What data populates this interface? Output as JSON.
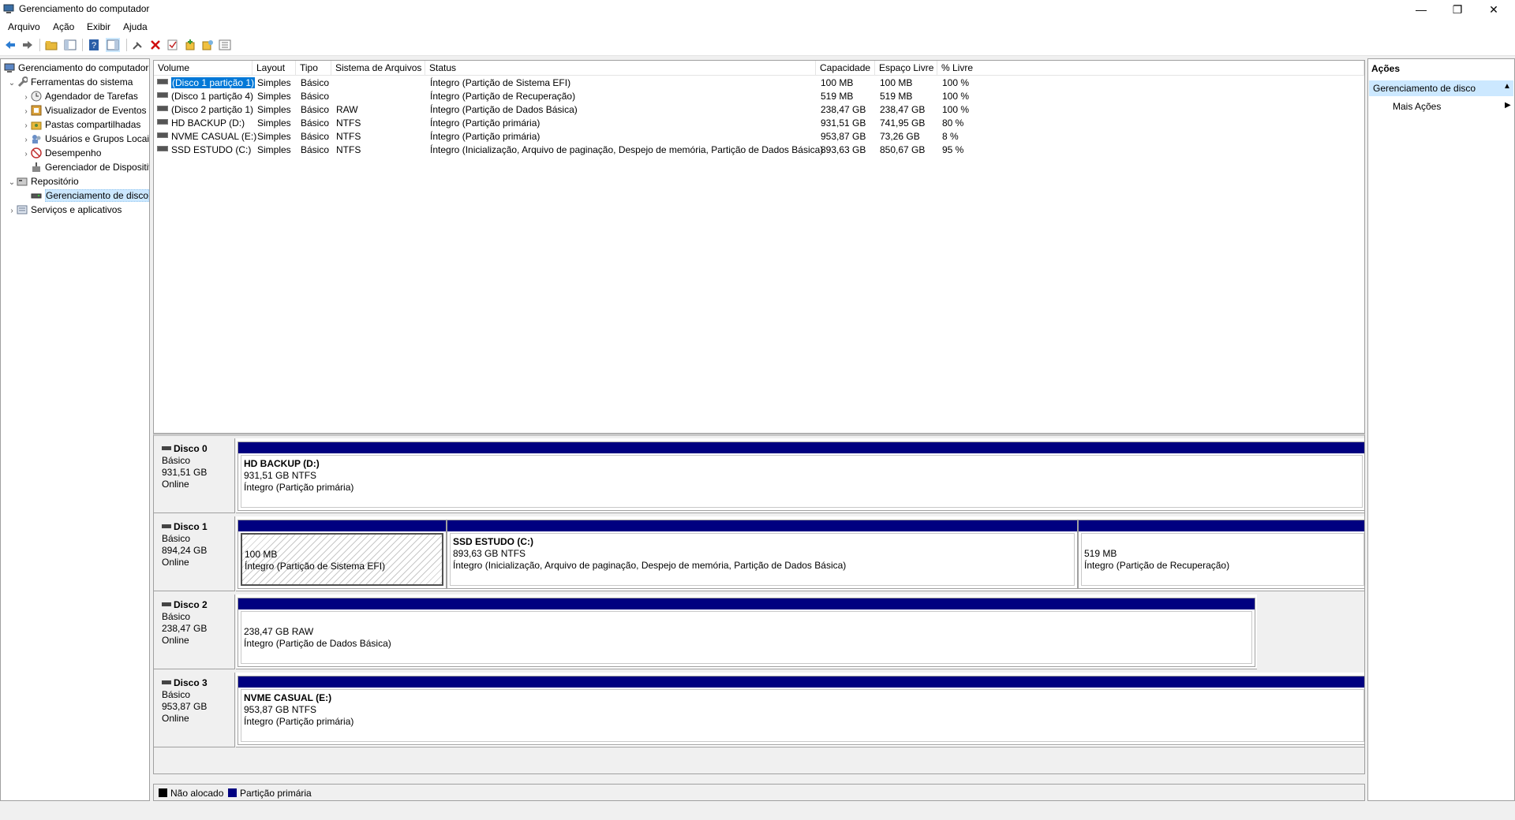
{
  "window": {
    "title": "Gerenciamento do computador",
    "controls": {
      "minimize": "—",
      "restore": "❐",
      "close": "✕"
    }
  },
  "menu": [
    "Arquivo",
    "Ação",
    "Exibir",
    "Ajuda"
  ],
  "toolbar": {
    "icons": [
      "back-arrow-icon",
      "forward-arrow-icon",
      "up-folder-icon",
      "show-hide-tree-icon",
      "help-icon",
      "console-view-icon",
      "connect-icon",
      "delete-icon",
      "check-icon",
      "new-icon",
      "properties-icon",
      "list-icon"
    ]
  },
  "tree": {
    "items": [
      {
        "label": "Gerenciamento do computador (Local)",
        "level": 0,
        "expander": ""
      },
      {
        "label": "Ferramentas do sistema",
        "level": 1,
        "expander": "⌄"
      },
      {
        "label": "Agendador de Tarefas",
        "level": 2,
        "expander": "›"
      },
      {
        "label": "Visualizador de Eventos",
        "level": 2,
        "expander": "›"
      },
      {
        "label": "Pastas compartilhadas",
        "level": 2,
        "expander": "›"
      },
      {
        "label": "Usuários e Grupos Locais",
        "level": 2,
        "expander": "›"
      },
      {
        "label": "Desempenho",
        "level": 2,
        "expander": "›"
      },
      {
        "label": "Gerenciador de Dispositivos",
        "level": 2,
        "expander": ""
      },
      {
        "label": "Repositório",
        "level": 1,
        "expander": "⌄"
      },
      {
        "label": "Gerenciamento de disco",
        "level": 2,
        "expander": ""
      },
      {
        "label": "Serviços e aplicativos",
        "level": 1,
        "expander": "›"
      }
    ]
  },
  "volumes": {
    "columns": [
      "Volume",
      "Layout",
      "Tipo",
      "Sistema de Arquivos",
      "Status",
      "Capacidade",
      "Espaço Livre",
      "% Livre"
    ],
    "rows": [
      [
        "(Disco 1 partição 1)",
        "Simples",
        "Básico",
        "",
        "Íntegro (Partição de Sistema EFI)",
        "100 MB",
        "100 MB",
        "100 %"
      ],
      [
        "(Disco 1 partição 4)",
        "Simples",
        "Básico",
        "",
        "Íntegro (Partição de Recuperação)",
        "519 MB",
        "519 MB",
        "100 %"
      ],
      [
        "(Disco 2 partição 1)",
        "Simples",
        "Básico",
        "RAW",
        "Íntegro (Partição de Dados Básica)",
        "238,47 GB",
        "238,47 GB",
        "100 %"
      ],
      [
        "HD BACKUP (D:)",
        "Simples",
        "Básico",
        "NTFS",
        "Íntegro (Partição primária)",
        "931,51 GB",
        "741,95 GB",
        "80 %"
      ],
      [
        "NVME CASUAL (E:)",
        "Simples",
        "Básico",
        "NTFS",
        "Íntegro (Partição primária)",
        "953,87 GB",
        "73,26 GB",
        "8 %"
      ],
      [
        "SSD ESTUDO (C:)",
        "Simples",
        "Básico",
        "NTFS",
        "Íntegro (Inicialização, Arquivo de paginação, Despejo de memória, Partição de Dados Básica)",
        "893,63 GB",
        "850,67 GB",
        "95 %"
      ]
    ]
  },
  "disks": [
    {
      "name": "Disco 0",
      "type": "Básico",
      "size": "931,51 GB",
      "state": "Online",
      "partitions": [
        {
          "name": "HD BACKUP  (D:)",
          "size": "931,51 GB NTFS",
          "status": "Íntegro (Partição primária)"
        }
      ]
    },
    {
      "name": "Disco 1",
      "type": "Básico",
      "size": "894,24 GB",
      "state": "Online",
      "partitions": [
        {
          "name": "",
          "size": "100 MB",
          "status": "Íntegro (Partição de Sistema EFI)"
        },
        {
          "name": "SSD ESTUDO  (C:)",
          "size": "893,63 GB NTFS",
          "status": "Íntegro (Inicialização, Arquivo de paginação, Despejo de memória, Partição de Dados Básica)"
        },
        {
          "name": "",
          "size": "519 MB",
          "status": "Íntegro (Partição de Recuperação)"
        }
      ]
    },
    {
      "name": "Disco 2",
      "type": "Básico",
      "size": "238,47 GB",
      "state": "Online",
      "partitions": [
        {
          "name": "",
          "size": "238,47 GB RAW",
          "status": "Íntegro (Partição de Dados Básica)"
        }
      ]
    },
    {
      "name": "Disco 3",
      "type": "Básico",
      "size": "953,87 GB",
      "state": "Online",
      "partitions": [
        {
          "name": "NVME CASUAL  (E:)",
          "size": "953,87 GB NTFS",
          "status": "Íntegro (Partição primária)"
        }
      ]
    }
  ],
  "legend": [
    {
      "label": "Não alocado",
      "color": "#000000"
    },
    {
      "label": "Partição primária",
      "color": "#000080"
    }
  ],
  "actions": {
    "title": "Ações",
    "section": "Gerenciamento de disco",
    "more": "Mais Ações"
  },
  "colors": {
    "partition_bar": "#000080",
    "selection": "#0078d7",
    "actions_header": "#cce8ff"
  }
}
